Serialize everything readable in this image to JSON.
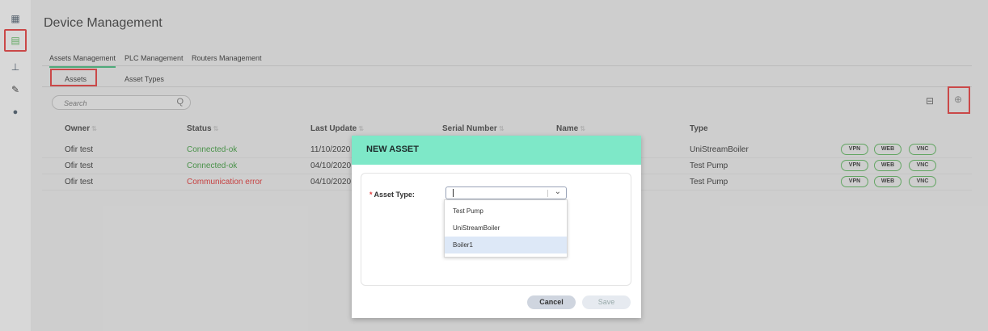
{
  "app": {
    "title": "Device Management"
  },
  "sidebar": {
    "items": [
      {
        "icon": "dashboard-icon",
        "glyph": "▦"
      },
      {
        "icon": "devices-icon",
        "glyph": "▤"
      },
      {
        "icon": "network-tree-icon",
        "glyph": "⊥"
      },
      {
        "icon": "pen-icon",
        "glyph": "✎"
      },
      {
        "icon": "users-icon",
        "glyph": "●"
      }
    ]
  },
  "tabs": [
    {
      "label": "Assets Management"
    },
    {
      "label": "PLC Management"
    },
    {
      "label": "Routers Management"
    }
  ],
  "subtabs": [
    {
      "label": "Assets"
    },
    {
      "label": "Asset Types"
    }
  ],
  "search": {
    "placeholder": "Search",
    "icon_glyph": "Q"
  },
  "toolbar": {
    "archive_glyph": "⊟",
    "add_glyph": "⊕"
  },
  "table": {
    "headers": {
      "owner": "Owner",
      "status": "Status",
      "last_update": "Last Update",
      "serial_number": "Serial Number",
      "name": "Name",
      "type": "Type",
      "sort_glyph": "⇅"
    },
    "rows": [
      {
        "owner": "Ofir test",
        "status": "Connected-ok",
        "last_update": "11/10/2020",
        "type": "UniStreamBoiler",
        "vpn": "VPN",
        "web": "WEB",
        "vnc": "VNC"
      },
      {
        "owner": "Ofir test",
        "status": "Connected-ok",
        "last_update": "04/10/2020",
        "type": "Test Pump",
        "vpn": "VPN",
        "web": "WEB",
        "vnc": "VNC"
      },
      {
        "owner": "Ofir test",
        "status": "Communication error",
        "last_update": "04/10/2020",
        "type": "Test Pump",
        "vpn": "VPN",
        "web": "WEB",
        "vnc": "VNC"
      }
    ]
  },
  "modal": {
    "title": "NEW ASSET",
    "asset_type_label": "Asset Type:",
    "required_mark": "*",
    "chevron_glyph": "⌄",
    "options": [
      "Test Pump",
      "UniStreamBoiler",
      "Boiler1"
    ],
    "highlighted_option": "Boiler1",
    "cancel_label": "Cancel",
    "save_label": "Save"
  },
  "colors": {
    "accent": "#45b97c",
    "modal_header": "#7ee8c8",
    "highlight_box": "#e23b3b",
    "status_ok": "#3e9a3e",
    "status_error": "#dd3333"
  }
}
